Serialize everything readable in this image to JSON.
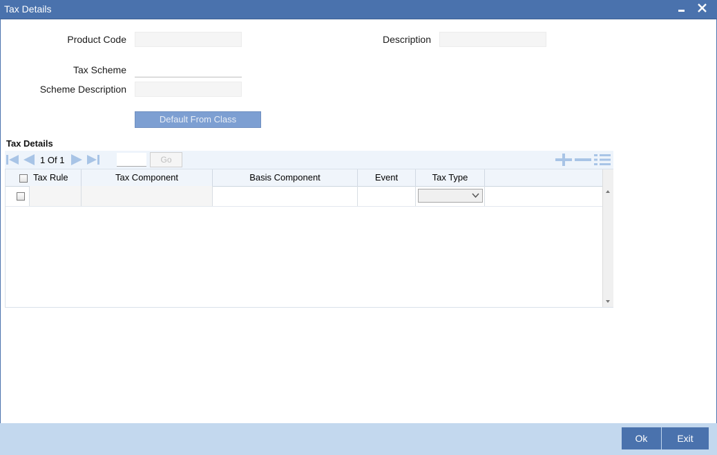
{
  "window": {
    "title": "Tax Details"
  },
  "form": {
    "product_code_label": "Product Code",
    "product_code_value": "",
    "description_label": "Description",
    "description_value": "",
    "tax_scheme_label": "Tax Scheme",
    "tax_scheme_value": "",
    "scheme_description_label": "Scheme Description",
    "scheme_description_value": "",
    "default_button": "Default From Class"
  },
  "grid": {
    "section_title": "Tax Details",
    "pager": {
      "current": "1",
      "of_label": "Of",
      "total": "1",
      "go_label": "Go",
      "page_input": ""
    },
    "columns": [
      "Tax Rule",
      "Tax Component",
      "Basis Component",
      "Event",
      "Tax Type"
    ],
    "rows": [
      {
        "tax_rule": "",
        "tax_component": "",
        "basis_component": "",
        "event": "",
        "tax_type": ""
      }
    ],
    "icons": [
      "first-page-icon",
      "previous-page-icon",
      "next-page-icon",
      "last-page-icon",
      "add-row-icon",
      "delete-row-icon",
      "single-view-icon"
    ]
  },
  "footer": {
    "ok_label": "Ok",
    "exit_label": "Exit"
  },
  "colors": {
    "title_bar": "#4a72ad",
    "accent_button": "#7d9fd2",
    "footer": "#c3d8ee",
    "nav_icon": "#a8c4e6"
  }
}
